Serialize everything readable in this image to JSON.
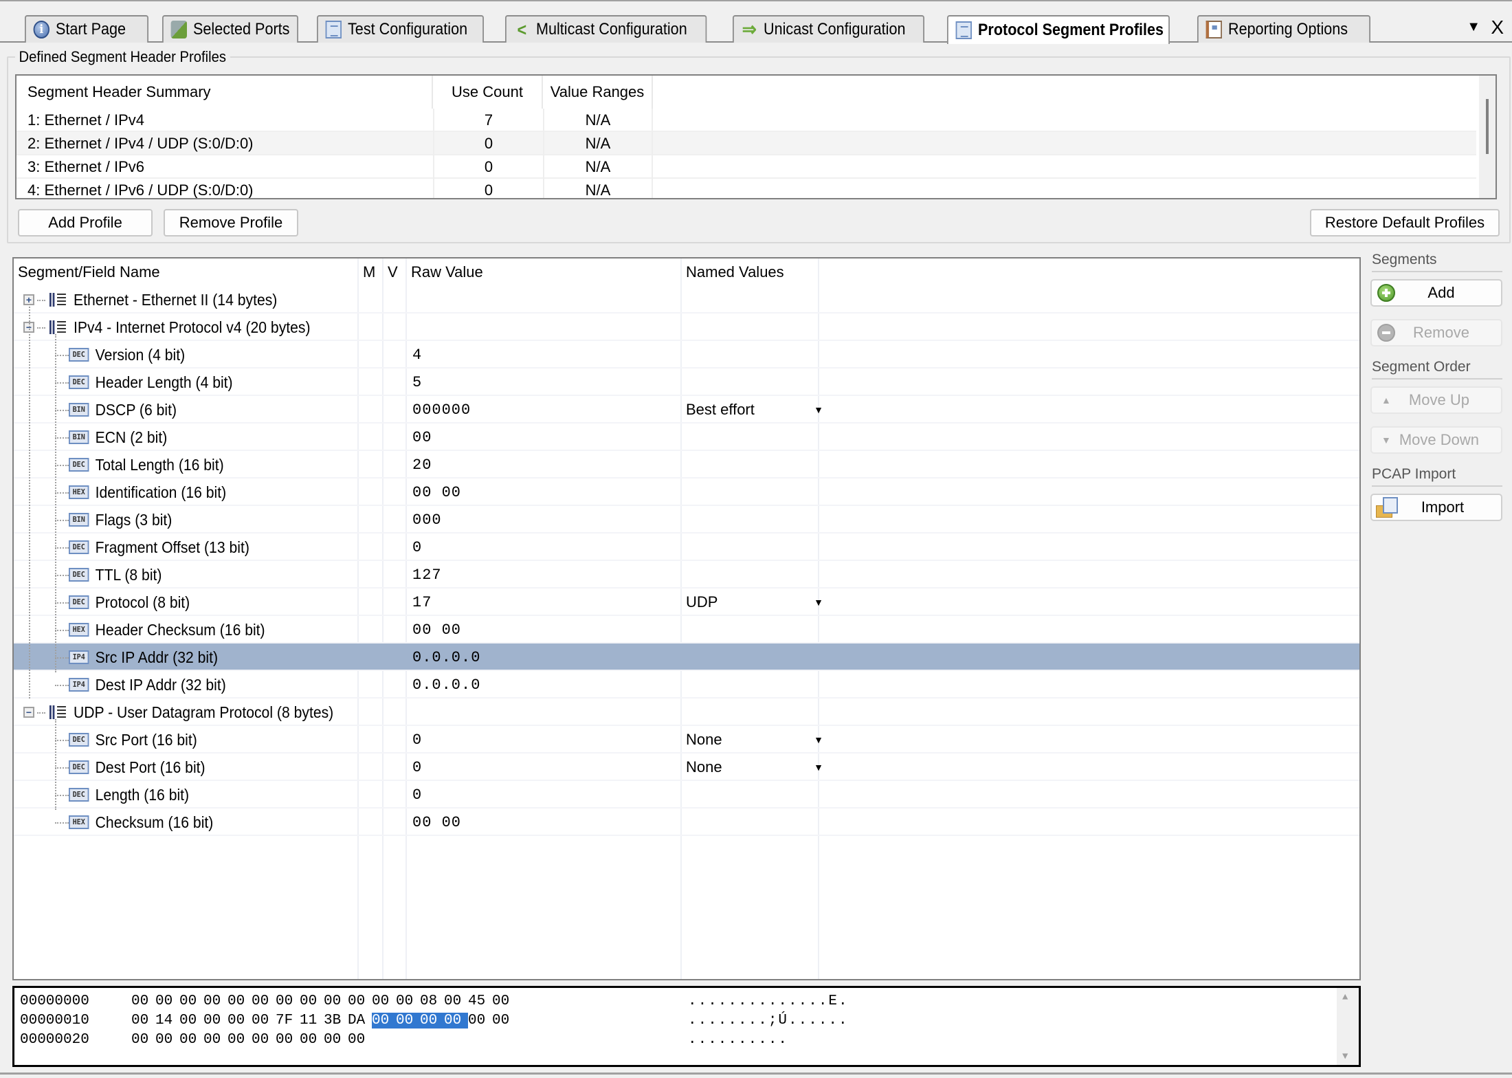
{
  "tabs": [
    {
      "label": "Start Page",
      "icon": "info-icon",
      "active": false
    },
    {
      "label": "Selected Ports",
      "icon": "ports-icon",
      "active": false
    },
    {
      "label": "Test Configuration",
      "icon": "document-icon",
      "active": false
    },
    {
      "label": "Multicast Configuration",
      "icon": "multicast-icon",
      "active": false
    },
    {
      "label": "Unicast Configuration",
      "icon": "arrow-right-icon",
      "active": false
    },
    {
      "label": "Protocol Segment Profiles",
      "icon": "document-icon",
      "active": true
    },
    {
      "label": "Reporting Options",
      "icon": "report-icon",
      "active": false
    }
  ],
  "tab_controls": {
    "menu": "▼",
    "close": "X"
  },
  "profiles": {
    "group_title": "Defined Segment Header Profiles",
    "columns": [
      "Segment Header Summary",
      "Use Count",
      "Value Ranges"
    ],
    "rows": [
      {
        "summary": "1: Ethernet / IPv4",
        "use_count": "7",
        "value_ranges": "N/A"
      },
      {
        "summary": "2: Ethernet / IPv4 / UDP (S:0/D:0)",
        "use_count": "0",
        "value_ranges": "N/A"
      },
      {
        "summary": "3: Ethernet / IPv6",
        "use_count": "0",
        "value_ranges": "N/A"
      },
      {
        "summary": "4: Ethernet / IPv6 / UDP (S:0/D:0)",
        "use_count": "0",
        "value_ranges": "N/A"
      }
    ],
    "add_button": "Add Profile",
    "remove_button": "Remove Profile",
    "restore_button": "Restore Default Profiles"
  },
  "tree": {
    "columns": [
      "Segment/Field Name",
      "M",
      "V",
      "Raw Value",
      "Named Values"
    ],
    "rows": [
      {
        "level": 0,
        "expander": "+",
        "name": "Ethernet - Ethernet II (14 bytes)",
        "raw": "",
        "named": ""
      },
      {
        "level": 0,
        "expander": "−",
        "name": "IPv4 - Internet Protocol v4 (20 bytes)",
        "raw": "",
        "named": ""
      },
      {
        "level": 1,
        "fmt": "DEC",
        "name": "Version (4 bit)",
        "raw": "4",
        "named": ""
      },
      {
        "level": 1,
        "fmt": "DEC",
        "name": "Header Length (4 bit)",
        "raw": "5",
        "named": ""
      },
      {
        "level": 1,
        "fmt": "BIN",
        "name": "DSCP (6 bit)",
        "raw": "000000",
        "named": "Best effort"
      },
      {
        "level": 1,
        "fmt": "BIN",
        "name": "ECN (2 bit)",
        "raw": "00",
        "named": ""
      },
      {
        "level": 1,
        "fmt": "DEC",
        "name": "Total Length (16 bit)",
        "raw": "20",
        "named": ""
      },
      {
        "level": 1,
        "fmt": "HEX",
        "name": "Identification (16 bit)",
        "raw": "00 00",
        "named": ""
      },
      {
        "level": 1,
        "fmt": "BIN",
        "name": "Flags (3 bit)",
        "raw": "000",
        "named": ""
      },
      {
        "level": 1,
        "fmt": "DEC",
        "name": "Fragment Offset (13 bit)",
        "raw": "0",
        "named": ""
      },
      {
        "level": 1,
        "fmt": "DEC",
        "name": "TTL (8 bit)",
        "raw": "127",
        "named": ""
      },
      {
        "level": 1,
        "fmt": "DEC",
        "name": "Protocol (8 bit)",
        "raw": "17",
        "named": "UDP"
      },
      {
        "level": 1,
        "fmt": "HEX",
        "name": "Header Checksum (16 bit)",
        "raw": "00 00",
        "named": ""
      },
      {
        "level": 1,
        "fmt": "IP4",
        "name": "Src IP Addr (32 bit)",
        "raw": "0.0.0.0",
        "named": "",
        "selected": true
      },
      {
        "level": 1,
        "fmt": "IP4",
        "name": "Dest IP Addr (32 bit)",
        "raw": "0.0.0.0",
        "named": ""
      },
      {
        "level": 0,
        "expander": "−",
        "name": "UDP - User Datagram Protocol (8 bytes)",
        "raw": "",
        "named": ""
      },
      {
        "level": 1,
        "fmt": "DEC",
        "name": "Src Port (16 bit)",
        "raw": "0",
        "named": "None"
      },
      {
        "level": 1,
        "fmt": "DEC",
        "name": "Dest Port (16 bit)",
        "raw": "0",
        "named": "None"
      },
      {
        "level": 1,
        "fmt": "DEC",
        "name": "Length (16 bit)",
        "raw": "0",
        "named": ""
      },
      {
        "level": 1,
        "fmt": "HEX",
        "name": "Checksum (16 bit)",
        "raw": "00 00",
        "named": ""
      }
    ]
  },
  "right_panel": {
    "segments_label": "Segments",
    "add": "Add",
    "remove": "Remove",
    "order_label": "Segment Order",
    "move_up": "Move Up",
    "move_down": "Move Down",
    "pcap_label": "PCAP Import",
    "import": "Import"
  },
  "hex_view": {
    "lines": [
      {
        "offset": "00000000",
        "bytes": [
          "00",
          "00",
          "00",
          "00",
          "00",
          "00",
          "00",
          "00",
          "00",
          "00",
          "00",
          "00",
          "08",
          "00",
          "45",
          "00"
        ],
        "ascii": "..............E."
      },
      {
        "offset": "00000010",
        "bytes": [
          "00",
          "14",
          "00",
          "00",
          "00",
          "00",
          "7F",
          "11",
          "3B",
          "DA",
          "00",
          "00",
          "00",
          "00",
          "00",
          "00"
        ],
        "ascii": "........;Ú......",
        "selected": [
          10,
          11,
          12,
          13
        ]
      },
      {
        "offset": "00000020",
        "bytes": [
          "00",
          "00",
          "00",
          "00",
          "00",
          "00",
          "00",
          "00",
          "00",
          "00"
        ],
        "ascii": ".........."
      }
    ]
  },
  "colors": {
    "selected_row": "#a0b3cd",
    "hex_selection": "#3178d0"
  }
}
